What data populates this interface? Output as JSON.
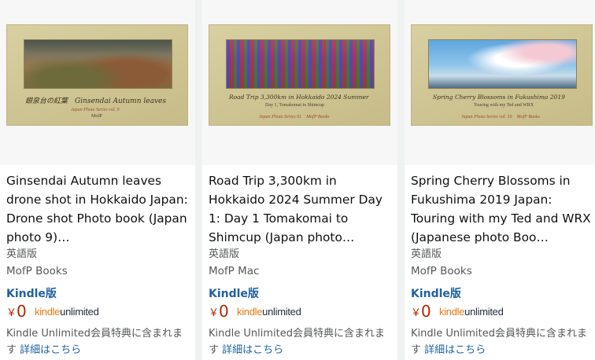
{
  "cards": [
    {
      "cover_title": "銀泉台の紅葉　Ginsendai Autumn leaves",
      "cover_sub": "",
      "cover_series": "Japan Photo Series vol. 9",
      "cover_publisher": "MofP",
      "title": "Ginsendai Autumn leaves drone shot in Hokkaido Japan: Drone shot Photo book (Japan photo 9)…",
      "language": "英語版",
      "author": "MofP Books",
      "format": "Kindle版",
      "currency": "￥",
      "price": "0",
      "ku_kindle": "kindle",
      "ku_unlimited": "unlimited",
      "note_text": "Kindle Unlimited会員特典に含まれます",
      "note_link": "詳細はこちら"
    },
    {
      "cover_title": "Road Trip 3,300km in Hokkaido 2024 Summer",
      "cover_sub": "Day 1, Tomakomai to Shimcup",
      "cover_series": "Japan Photo Series 61　MofP Books",
      "cover_publisher": "",
      "title": "Road Trip 3,300km in Hokkaido 2024 Summer Day 1: Day 1 Tomakomai to Shimcup (Japan photo…",
      "language": "英語版",
      "author": "MofP Mac",
      "format": "Kindle版",
      "currency": "￥",
      "price": "0",
      "ku_kindle": "kindle",
      "ku_unlimited": "unlimited",
      "note_text": "Kindle Unlimited会員特典に含まれます",
      "note_link": "詳細はこちら"
    },
    {
      "cover_title": "Spring Cherry Blossoms in Fukushima 2019",
      "cover_sub": "Touring with my Ted and WRX",
      "cover_series": "Japan Photo Series vol. 59　MofP Books",
      "cover_publisher": "",
      "title": "Spring Cherry Blossoms in Fukushima 2019 Japan: Touring with my Ted and WRX (Japanese photo Boo…",
      "language": "英語版",
      "author": "MofP Books",
      "format": "Kindle版",
      "currency": "￥",
      "price": "0",
      "ku_kindle": "kindle",
      "ku_unlimited": "unlimited",
      "note_text": "Kindle Unlimited会員特典に含まれます",
      "note_link": "詳細はこちら"
    }
  ],
  "colors": {
    "link_blue": "#2162a1",
    "price_red": "#b12704",
    "ku_orange": "#e47911",
    "secondary_text": "#565959"
  }
}
